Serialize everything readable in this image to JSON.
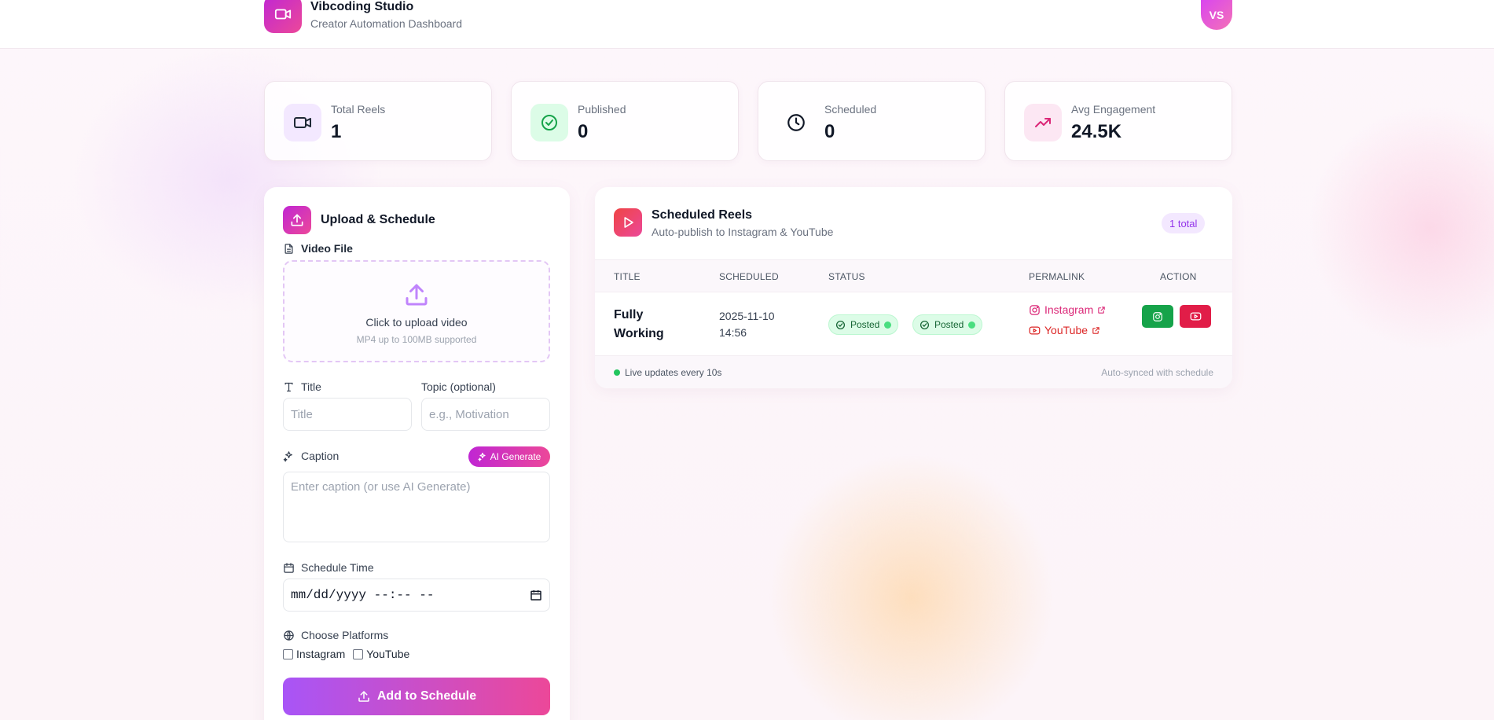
{
  "header": {
    "brand_name": "Vibcoding Studio",
    "brand_subtitle": "Creator Automation Dashboard",
    "avatar_initials": "VS"
  },
  "stats": [
    {
      "label": "Total Reels",
      "value": "1",
      "icon": "video-icon"
    },
    {
      "label": "Published",
      "value": "0",
      "icon": "check-circle-icon"
    },
    {
      "label": "Scheduled",
      "value": "0",
      "icon": "clock-icon"
    },
    {
      "label": "Avg Engagement",
      "value": "24.5K",
      "icon": "trending-up-icon"
    }
  ],
  "upload": {
    "title": "Upload & Schedule",
    "video_label": "Video File",
    "dropzone_text": "Click to upload video",
    "dropzone_hint": "MP4 up to 100MB supported",
    "title_label": "Title",
    "title_placeholder": "Title",
    "topic_label": "Topic (optional)",
    "topic_placeholder": "e.g., Motivation",
    "caption_label": "Caption",
    "ai_button": "AI Generate",
    "caption_placeholder": "Enter caption (or use AI Generate)",
    "schedule_label": "Schedule Time",
    "schedule_value": "mm/dd/yyyy --:-- --",
    "platforms_label": "Choose Platforms",
    "platforms": [
      {
        "label": "Instagram",
        "checked": false
      },
      {
        "label": "YouTube",
        "checked": false
      }
    ],
    "submit_label": "Add to Schedule"
  },
  "scheduled": {
    "title": "Scheduled Reels",
    "subtitle": "Auto-publish to Instagram & YouTube",
    "count_badge": "1 total",
    "columns": [
      "TITLE",
      "SCHEDULED",
      "STATUS",
      "PERMALINK",
      "ACTION"
    ],
    "rows": [
      {
        "title": "Fully Working",
        "scheduled": "2025-11-10 14:56",
        "statuses": [
          "Posted",
          "Posted"
        ],
        "permalinks": [
          "Instagram",
          "YouTube"
        ]
      }
    ],
    "footer_live": "Live updates every 10s",
    "footer_sync": "Auto-synced with schedule"
  },
  "colors": {
    "brand_gradient_start": "#c026d3",
    "brand_gradient_end": "#ec4899",
    "instagram_button": "#16a34a",
    "youtube_button": "#e11d48",
    "status_green": "#dcfce7"
  }
}
